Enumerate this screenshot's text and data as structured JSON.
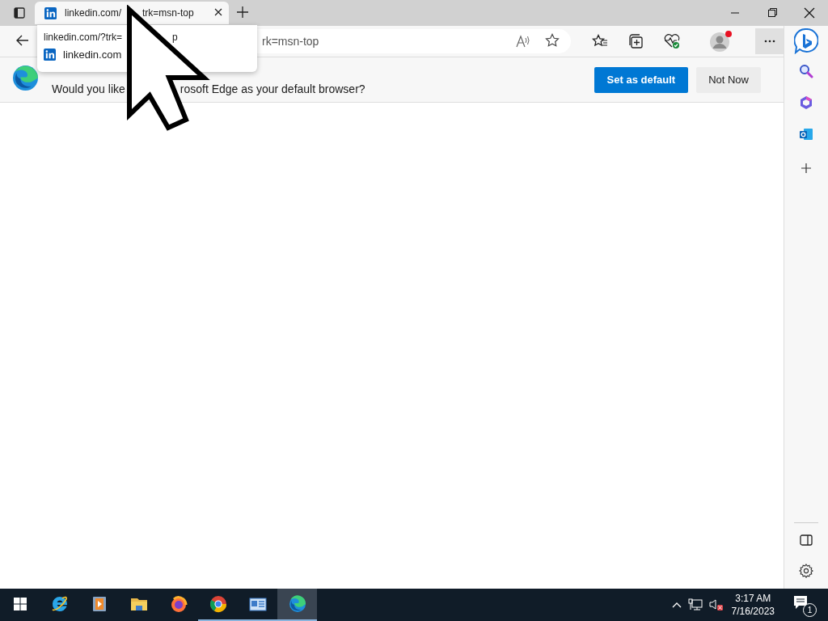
{
  "tab": {
    "title_start": "linkedin.com/",
    "title_end": "trk=msn-top",
    "selected": true
  },
  "tooltip": {
    "url": "linkedin.com/?trk=",
    "url_tail": "p",
    "site": "linkedin.com"
  },
  "address_bar": {
    "value": "rk=msn-top"
  },
  "profile": {
    "notification": true
  },
  "banner": {
    "message_start": "Would you like",
    "message_end": "rosoft Edge as your default browser?",
    "buttons": [
      {
        "label": "Set as default",
        "kind": "primary"
      },
      {
        "label": "Not Now",
        "kind": "secondary"
      }
    ]
  },
  "taskbar": {
    "apps": [
      {
        "kind": "ie",
        "running": false,
        "selected": false
      },
      {
        "kind": "media",
        "running": false,
        "selected": false
      },
      {
        "kind": "folder",
        "running": false,
        "selected": false
      },
      {
        "kind": "firefox",
        "running": false,
        "selected": false
      },
      {
        "kind": "chrome",
        "running": true,
        "selected": false
      },
      {
        "kind": "control",
        "running": true,
        "selected": false
      },
      {
        "kind": "edge",
        "running": true,
        "selected": true
      }
    ],
    "time": "3:17 AM",
    "date": "7/16/2023",
    "notification_count": "1"
  }
}
